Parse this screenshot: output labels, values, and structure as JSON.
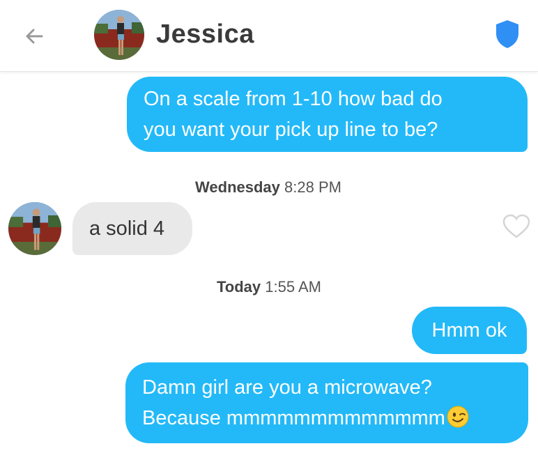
{
  "header": {
    "title": "Jessica",
    "accent": "#23b9f8",
    "shield_color": "#2f8ff5"
  },
  "messages": [
    {
      "from": "me",
      "text": "On a scale from 1-10 how bad do\nyou want your pick up line to be?"
    },
    {
      "from": "them",
      "text": "a solid 4"
    },
    {
      "from": "me",
      "text": "Hmm ok"
    },
    {
      "from": "me",
      "text": "Damn girl are you a microwave?\nBecause mmmmmmmmmmmmm",
      "emoji": "winking-face"
    }
  ],
  "timestamps": [
    {
      "day": "Wednesday",
      "time": "8:28 PM"
    },
    {
      "day": "Today",
      "time": "1:55 AM"
    }
  ],
  "icons": {
    "back": "back-arrow-icon",
    "safety": "shield-icon",
    "like": "heart-icon"
  }
}
